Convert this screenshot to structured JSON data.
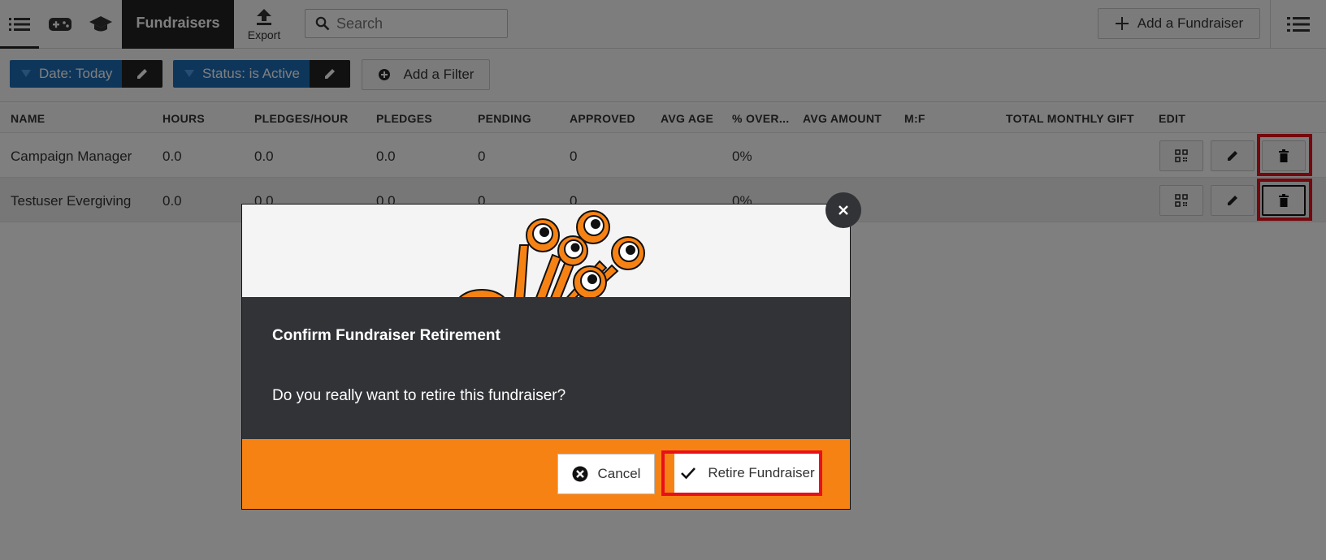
{
  "toolbar": {
    "active_tab": "Fundraisers",
    "export_label": "Export",
    "search_placeholder": "Search",
    "add_button": "Add a Fundraiser"
  },
  "filters": {
    "date": "Date: Today",
    "status": "Status: is Active",
    "add": "Add a Filter"
  },
  "table": {
    "headers": [
      "NAME",
      "HOURS",
      "PLEDGES/HOUR",
      "PLEDGES",
      "PENDING",
      "APPROVED",
      "AVG AGE",
      "% OVER...",
      "AVG AMOUNT",
      "M:F",
      "TOTAL MONTHLY GIFT",
      "EDIT"
    ],
    "rows": [
      {
        "name": "Campaign Manager",
        "hours": "0.0",
        "pledges_hour": "0.0",
        "pledges": "0.0",
        "pending": "0",
        "approved": "0",
        "avg_age": "",
        "over": "0%",
        "avg_amount": "",
        "mf": "",
        "monthly": ""
      },
      {
        "name": "Testuser Evergiving",
        "hours": "0.0",
        "pledges_hour": "0.0",
        "pledges": "0.0",
        "pending": "0",
        "approved": "0",
        "avg_age": "",
        "over": "0%",
        "avg_amount": "",
        "mf": "",
        "monthly": ""
      }
    ]
  },
  "modal": {
    "title": "Confirm Fundraiser Retirement",
    "message": "Do you really want to retire this fundraiser?",
    "cancel": "Cancel",
    "confirm": "Retire Fundraiser"
  },
  "colors": {
    "accent_blue": "#1d6cb7",
    "modal_dark": "#323337",
    "modal_orange": "#f78214",
    "highlight_red": "#e8101a"
  }
}
